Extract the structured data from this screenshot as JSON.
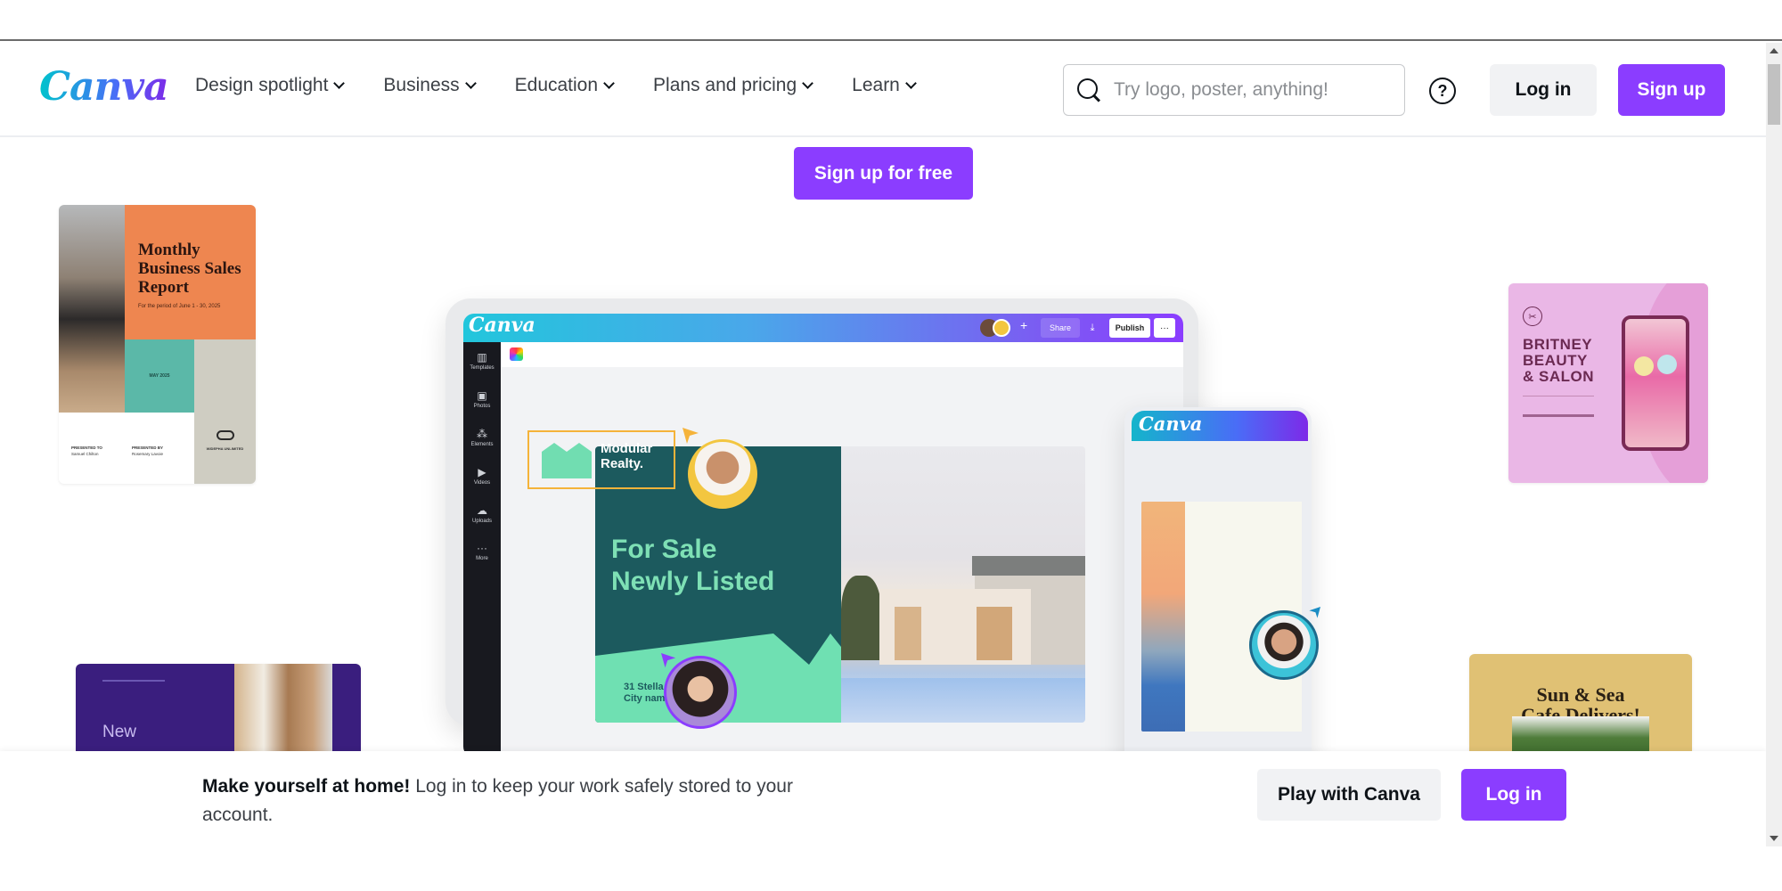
{
  "brand": {
    "logo": "Canva",
    "accent": "#8b3dff",
    "logo_gradient": [
      "#00c4cc",
      "#4a6cf7",
      "#7d2ae8"
    ]
  },
  "nav": {
    "items": [
      {
        "label": "Design spotlight",
        "icon": "chevron-down-icon"
      },
      {
        "label": "Business",
        "icon": "chevron-down-icon"
      },
      {
        "label": "Education",
        "icon": "chevron-down-icon"
      },
      {
        "label": "Plans and pricing",
        "icon": "chevron-down-icon"
      },
      {
        "label": "Learn",
        "icon": "chevron-down-icon"
      }
    ],
    "search": {
      "placeholder": "Try logo, poster, anything!",
      "value": "",
      "icon": "search-icon"
    },
    "help_icon": "?",
    "login_label": "Log in",
    "signup_label": "Sign up"
  },
  "hero": {
    "cta_label": "Sign up for free"
  },
  "templates": {
    "report": {
      "title": "Monthly Business Sales Report",
      "subtitle": "For the period of June 1 - 30, 2025",
      "date": "MAY 2025",
      "presented_to_label": "PRESENTED TO",
      "presented_to": "Samuel Chilton",
      "presented_by_label": "PRESENTED BY",
      "presented_by": "Rosemary Lavoie",
      "brand": "WIDEPHA UNLIMITED"
    },
    "salon": {
      "title_lines": [
        "BRITNEY",
        "BEAUTY",
        "& SALON"
      ]
    },
    "purple": {
      "title": "New"
    },
    "cafe": {
      "title_lines": [
        "Sun & Sea",
        "Cafe Delivers!"
      ]
    }
  },
  "editor": {
    "logo": "Canva",
    "share_label": "Share",
    "publish_label": "Publish",
    "more_label": "···",
    "sidebar": [
      {
        "label": "Templates",
        "icon": "▥"
      },
      {
        "label": "Photos",
        "icon": "▣"
      },
      {
        "label": "Elements",
        "icon": "⁂"
      },
      {
        "label": "Videos",
        "icon": "▶"
      },
      {
        "label": "Uploads",
        "icon": "☁"
      },
      {
        "label": "More",
        "icon": "···"
      }
    ],
    "design": {
      "logo_text_lines": [
        "Modular",
        "Realty."
      ],
      "headline_lines": [
        "For Sale",
        "Newly Listed"
      ],
      "address_lines": [
        "31 Stella",
        "City nam"
      ]
    },
    "mobile_logo": "Canva"
  },
  "banner": {
    "message_bold": "Make yourself at home!",
    "message": " Log in to keep your work safely stored to your account.",
    "play_label": "Play with Canva",
    "login_label": "Log in"
  }
}
